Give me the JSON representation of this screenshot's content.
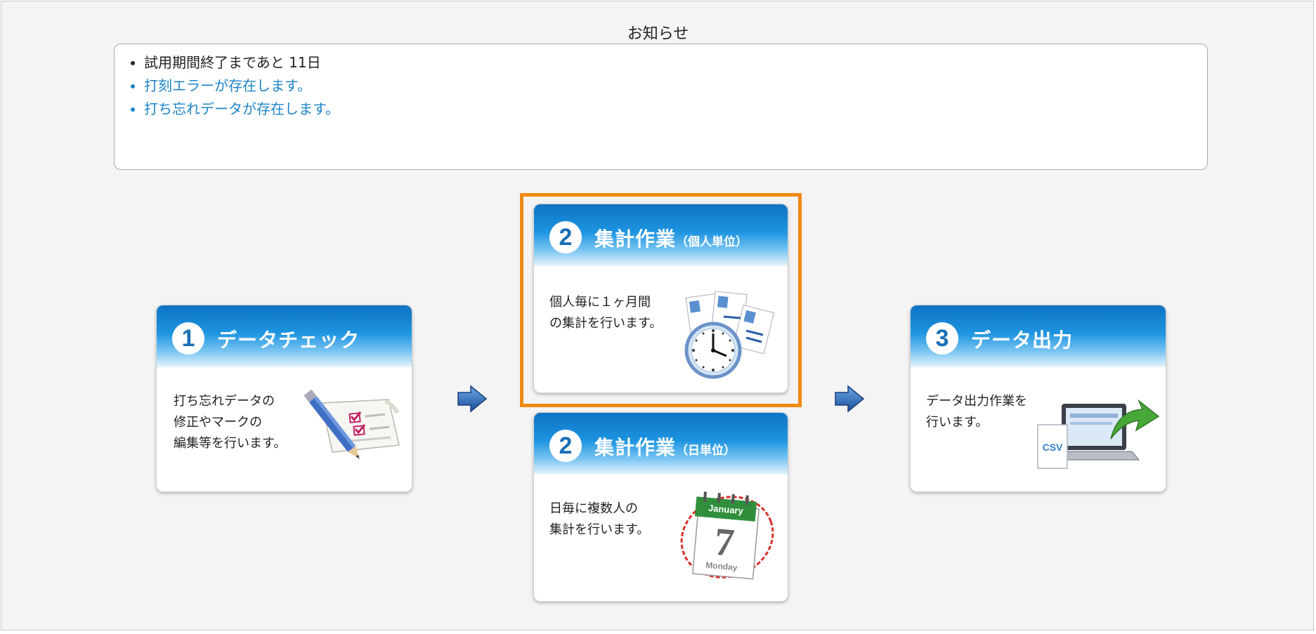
{
  "notice": {
    "title": "お知らせ",
    "items": [
      {
        "text": "試用期間終了まであと 11日"
      },
      {
        "text": "打刻エラーが存在します。"
      },
      {
        "text": "打ち忘れデータが存在します。"
      }
    ]
  },
  "cards": {
    "data_check": {
      "num": "1",
      "title": "データチェック",
      "desc": "打ち忘れデータの\n修正やマークの\n編集等を行います。"
    },
    "agg_personal": {
      "num": "2",
      "title": "集計作業",
      "sub": "（個人単位）",
      "desc": "個人毎に１ヶ月間\nの集計を行います。"
    },
    "agg_daily": {
      "num": "2",
      "title": "集計作業",
      "sub": "（日単位）",
      "desc": "日毎に複数人の\n集計を行います。",
      "calendar_month": "January",
      "calendar_day": "7",
      "calendar_weekday": "Monday"
    },
    "data_output": {
      "num": "3",
      "title": "データ出力",
      "desc": "データ出力作業を\n行います。",
      "csv_label": "CSV"
    }
  },
  "colors": {
    "accent": "#ef8a12",
    "link": "#1b84c9",
    "header_blue": "#1e94e0"
  },
  "icons": [
    "pencil-checklist-icon",
    "clock-timecards-icon",
    "calendar-icon",
    "csv-export-icon",
    "right-arrow-icon"
  ]
}
